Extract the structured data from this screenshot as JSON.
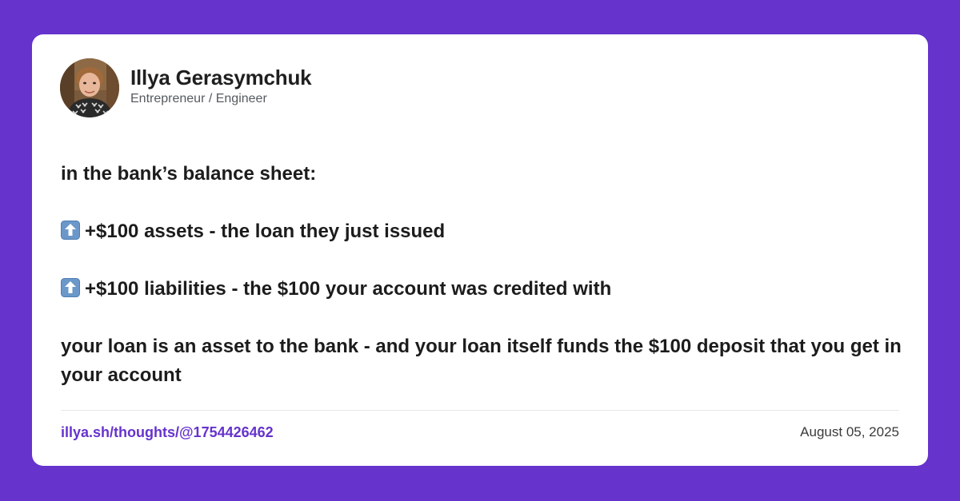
{
  "colors": {
    "background": "#6633cc",
    "card": "#ffffff",
    "link": "#6633cc",
    "arrow_badge": "#6b97c9"
  },
  "author": {
    "name": "Illya Gerasymchuk",
    "role": "Entrepreneur / Engineer"
  },
  "post": {
    "intro": "in the bank’s balance sheet:",
    "items": [
      {
        "icon": "up-arrow-icon",
        "text": "+$100 assets - the loan they just issued"
      },
      {
        "icon": "up-arrow-icon",
        "text": "+$100 liabilities - the $100 your account was credited with"
      }
    ],
    "conclusion": "your loan is an asset to the bank - and your loan itself funds the $100 deposit that you get in your account"
  },
  "footer": {
    "link": "illya.sh/thoughts/@1754426462",
    "date": "August 05, 2025"
  }
}
